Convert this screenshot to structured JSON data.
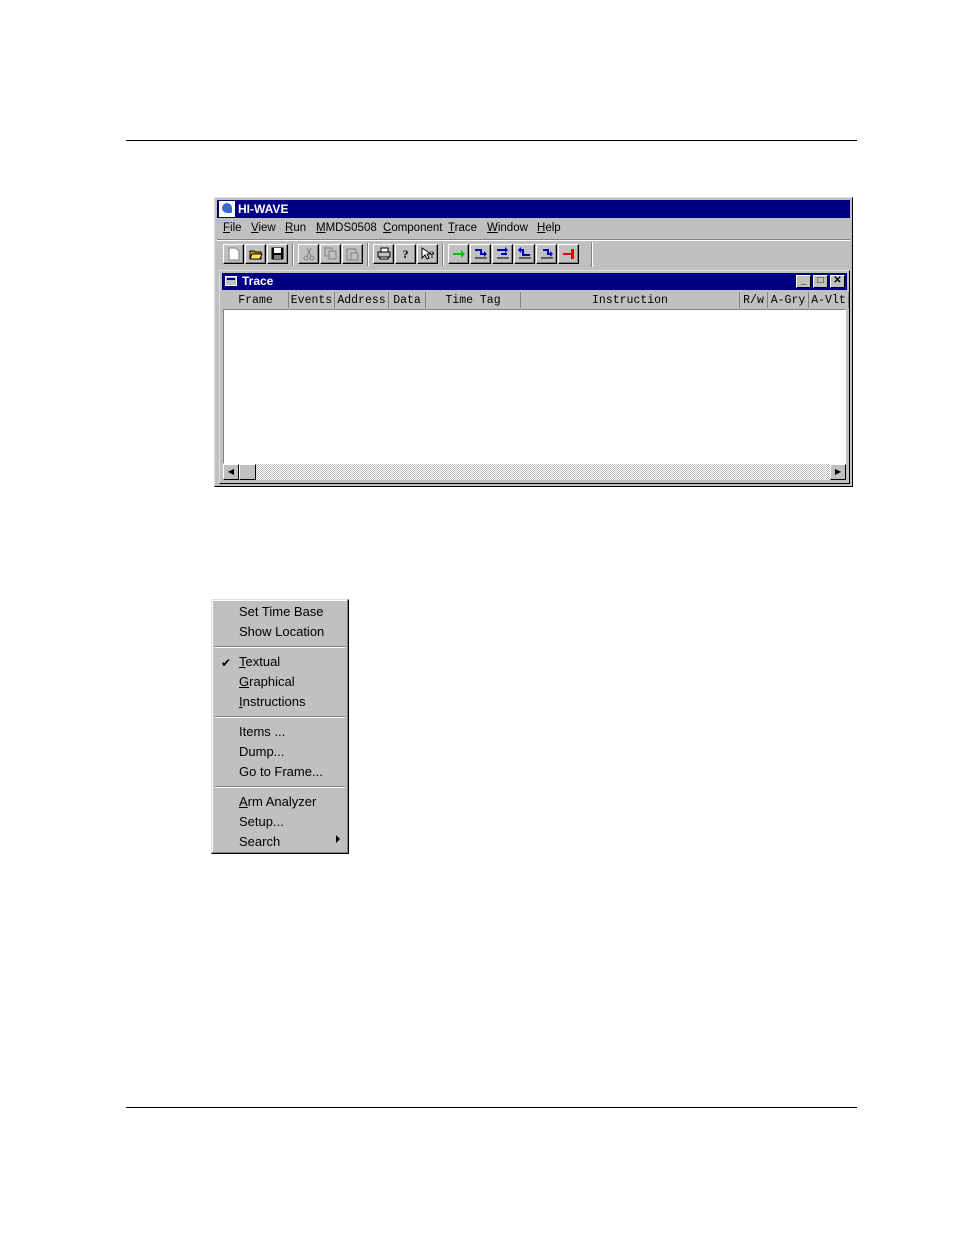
{
  "app": {
    "title": "HI-WAVE",
    "menu": [
      "File",
      "View",
      "Run",
      "MMDS0508",
      "Component",
      "Trace",
      "Window",
      "Help"
    ],
    "toolbar_icons": [
      "new-file-icon",
      "open-folder-icon",
      "save-icon",
      "cut-icon",
      "copy-icon",
      "paste-icon",
      "print-icon",
      "help-icon",
      "context-help-icon",
      "start-icon",
      "single-step-icon",
      "step-over-icon",
      "step-out-icon",
      "assembly-step-icon",
      "halt-icon"
    ],
    "colors": {
      "titlebar": "#000080",
      "window": "#c0c0c0",
      "start_arrow": "#00c000",
      "step_arrows": "#0000c0",
      "halt_arrow": "#e00000"
    }
  },
  "trace_window": {
    "title": "Trace",
    "columns": [
      "Frame",
      "Events",
      "Address",
      "Data",
      "Time Tag",
      "Instruction",
      "R/w",
      "A-Gry",
      "A-Vlt"
    ]
  },
  "context_menu": {
    "groups": [
      [
        {
          "label": "Set Time Base"
        },
        {
          "label": "Show Location"
        }
      ],
      [
        {
          "label": "Textual",
          "checked": true,
          "mnemonic": "T"
        },
        {
          "label": "Graphical",
          "mnemonic": "G"
        },
        {
          "label": "Instructions",
          "mnemonic": "I"
        }
      ],
      [
        {
          "label": "Items ..."
        },
        {
          "label": "Dump..."
        },
        {
          "label": "Go to Frame..."
        }
      ],
      [
        {
          "label": "Arm Analyzer",
          "mnemonic": "A"
        },
        {
          "label": "Setup..."
        },
        {
          "label": "Search",
          "submenu": true
        }
      ]
    ]
  }
}
